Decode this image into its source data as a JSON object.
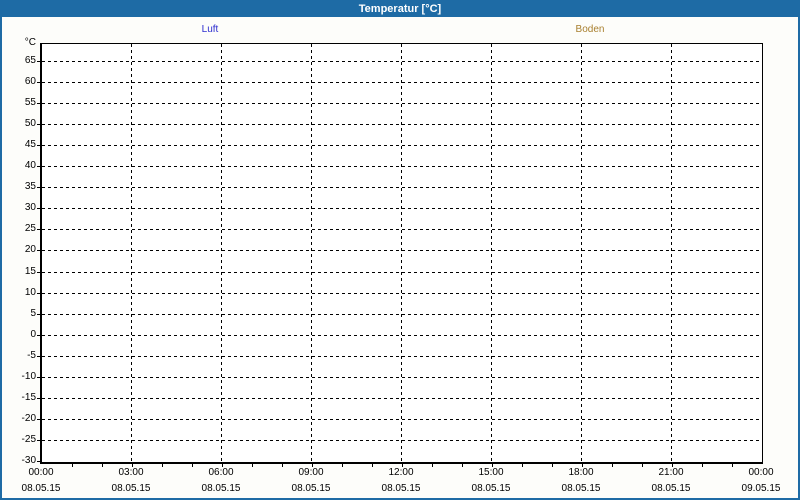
{
  "window": {
    "title": "Temperatur [°C]"
  },
  "colors": {
    "titlebar_bg": "#1e6ba5",
    "window_border": "#1e6ba5",
    "luft": "#2d2dcf",
    "boden": "#a87f2e",
    "grid": "#000000",
    "plot_bg": "#ffffff"
  },
  "chart_data": {
    "type": "line",
    "title": "Temperatur [°C]",
    "ylabel": "°C",
    "grid": "dashed",
    "plot_empty": true,
    "y_axis": {
      "unit": "°C",
      "min": -30,
      "max_tick": 65,
      "tick_step": 5,
      "ticks": [
        65,
        60,
        55,
        50,
        45,
        40,
        35,
        30,
        25,
        20,
        15,
        10,
        5,
        0,
        -5,
        -10,
        -15,
        -20,
        -25,
        -30
      ]
    },
    "x_axis": {
      "major_step_hours": 3,
      "minor_step_hours": 1,
      "times": [
        "00:00",
        "03:00",
        "06:00",
        "09:00",
        "12:00",
        "15:00",
        "18:00",
        "21:00",
        "00:00"
      ],
      "dates": [
        "08.05.15",
        "08.05.15",
        "08.05.15",
        "08.05.15",
        "08.05.15",
        "08.05.15",
        "08.05.15",
        "08.05.15",
        "09.05.15"
      ]
    },
    "legend": [
      {
        "name": "Luft",
        "color": "#2d2dcf"
      },
      {
        "name": "Boden",
        "color": "#a87f2e"
      }
    ],
    "series": [
      {
        "name": "Luft",
        "values": []
      },
      {
        "name": "Boden",
        "values": []
      }
    ]
  }
}
